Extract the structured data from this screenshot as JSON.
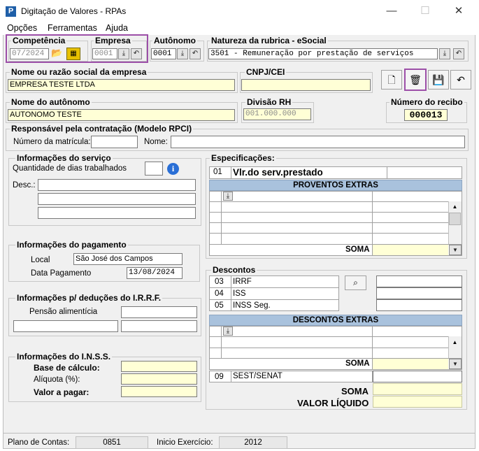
{
  "window": {
    "title": "Digitação de Valores - RPAs",
    "app_icon": "P",
    "minimize": "—",
    "maximize": "☐",
    "close": "✕"
  },
  "menu": [
    "Opções",
    "Ferramentas",
    "Ajuda"
  ],
  "competencia": {
    "label": "Competência",
    "value": "07/2024"
  },
  "empresa": {
    "label": "Empresa",
    "value": "0001"
  },
  "autonomo": {
    "label": "Autônomo",
    "value": "0001"
  },
  "natureza": {
    "label": "Natureza da rubrica - eSocial",
    "value": "3501 - Remuneração por prestação de serviços"
  },
  "nome_empresa": {
    "label": "Nome ou razão social da empresa",
    "value": "EMPRESA TESTE LTDA"
  },
  "cnpj": {
    "label": "CNPJ/CEI",
    "value": ""
  },
  "nome_autonomo": {
    "label": "Nome do autônomo",
    "value": "AUTONOMO TESTE"
  },
  "divisao": {
    "label": "Divisão RH",
    "value": "001.000.000"
  },
  "recibo": {
    "label": "Número do recibo",
    "value": "000013"
  },
  "responsavel": {
    "label": "Responsável pela contratação (Modelo RPCI)",
    "matricula_label": "Número da matrícula:",
    "nome_label": "Nome:",
    "matricula": "",
    "nome": ""
  },
  "servico": {
    "label": "Informações do serviço",
    "dias_label": "Quantidade de dias trabalhados",
    "dias": "",
    "desc_label": "Desc.:"
  },
  "pagamento": {
    "label": "Informações do pagamento",
    "local_label": "Local",
    "local": "São José dos Campos",
    "data_label": "Data Pagamento",
    "data": "13/08/2024"
  },
  "irrf": {
    "label": "Informações p/ deduções do I.R.R.F.",
    "pensao_label": "Pensão alimentícia"
  },
  "inss": {
    "label": "Informações do I.N.S.S.",
    "base_label": "Base de cálculo:",
    "aliquota_label": "Alíquota (%):",
    "valor_label": "Valor a pagar:"
  },
  "especificacoes": {
    "label": "Especificações:",
    "code": "01",
    "item": "Vlr.do serv.prestado",
    "proventos_header": "PROVENTOS EXTRAS",
    "soma": "SOMA"
  },
  "descontos": {
    "label": "Descontos",
    "items": [
      {
        "code": "03",
        "name": "IRRF"
      },
      {
        "code": "04",
        "name": "ISS"
      },
      {
        "code": "05",
        "name": "INSS Seg."
      }
    ],
    "extras_header": "DESCONTOS EXTRAS",
    "soma": "SOMA",
    "sest_code": "09",
    "sest_name": "SEST/SENAT"
  },
  "totais": {
    "soma": "SOMA",
    "valor_liquido": "VALOR LÍQUIDO"
  },
  "status": {
    "plano_label": "Plano de Contas:",
    "plano": "0851",
    "inicio_label": "Inicio Exercício:",
    "inicio": "2012"
  },
  "colors": {
    "highlight_border": "#9c4fa8",
    "grid_header": "#a9c2dd",
    "input_yellow": "#ffffd6"
  }
}
